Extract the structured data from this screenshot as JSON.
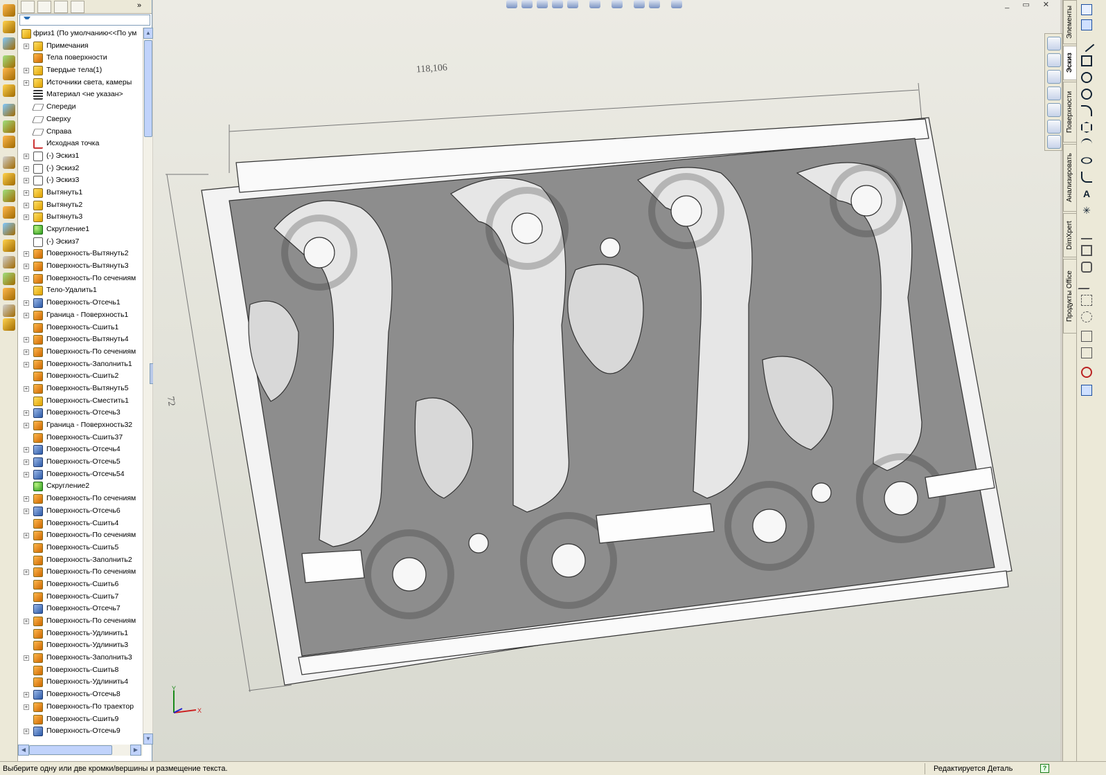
{
  "feature_tree": {
    "root": "фриз1  (По умолчанию<<По ум",
    "items": [
      {
        "label": "Примечания",
        "kind": "annot",
        "expand": true
      },
      {
        "label": "Тела поверхности",
        "kind": "surf",
        "expand": false
      },
      {
        "label": "Твердые тела(1)",
        "kind": "solid",
        "expand": true
      },
      {
        "label": "Источники света, камеры",
        "kind": "light",
        "expand": true
      },
      {
        "label": "Материал <не указан>",
        "kind": "mat",
        "expand": false
      },
      {
        "label": "Спереди",
        "kind": "plane",
        "expand": false
      },
      {
        "label": "Сверху",
        "kind": "plane",
        "expand": false
      },
      {
        "label": "Справа",
        "kind": "plane",
        "expand": false
      },
      {
        "label": "Исходная точка",
        "kind": "origin",
        "expand": false
      },
      {
        "label": "(-) Эскиз1",
        "kind": "sketch",
        "expand": true
      },
      {
        "label": "(-) Эскиз2",
        "kind": "sketch",
        "expand": true
      },
      {
        "label": "(-) Эскиз3",
        "kind": "sketch",
        "expand": true
      },
      {
        "label": "Вытянуть1",
        "kind": "solid",
        "expand": true
      },
      {
        "label": "Вытянуть2",
        "kind": "solid",
        "expand": true
      },
      {
        "label": "Вытянуть3",
        "kind": "solid",
        "expand": true
      },
      {
        "label": "Скругление1",
        "kind": "fillet",
        "expand": false
      },
      {
        "label": "(-) Эскиз7",
        "kind": "sketch",
        "expand": false
      },
      {
        "label": "Поверхность-Вытянуть2",
        "kind": "surf",
        "expand": true
      },
      {
        "label": "Поверхность-Вытянуть3",
        "kind": "surf",
        "expand": true
      },
      {
        "label": "Поверхность-По сечениям",
        "kind": "surf",
        "expand": true
      },
      {
        "label": "Тело-Удалить1",
        "kind": "solid",
        "expand": false
      },
      {
        "label": "Поверхность-Отсечь1",
        "kind": "cut",
        "expand": true
      },
      {
        "label": "Граница - Поверхность1",
        "kind": "surf",
        "expand": true
      },
      {
        "label": "Поверхность-Сшить1",
        "kind": "surf",
        "expand": false
      },
      {
        "label": "Поверхность-Вытянуть4",
        "kind": "surf",
        "expand": true
      },
      {
        "label": "Поверхность-По сечениям",
        "kind": "surf",
        "expand": true
      },
      {
        "label": "Поверхность-Заполнить1",
        "kind": "surf",
        "expand": true
      },
      {
        "label": "Поверхность-Сшить2",
        "kind": "surf",
        "expand": false
      },
      {
        "label": "Поверхность-Вытянуть5",
        "kind": "surf",
        "expand": true
      },
      {
        "label": "Поверхность-Сместить1",
        "kind": "solid",
        "expand": false
      },
      {
        "label": "Поверхность-Отсечь3",
        "kind": "cut",
        "expand": true
      },
      {
        "label": "Граница - Поверхность32",
        "kind": "surf",
        "expand": true
      },
      {
        "label": "Поверхность-Сшить37",
        "kind": "surf",
        "expand": false
      },
      {
        "label": "Поверхность-Отсечь4",
        "kind": "cut",
        "expand": true
      },
      {
        "label": "Поверхность-Отсечь5",
        "kind": "cut",
        "expand": true
      },
      {
        "label": "Поверхность-Отсечь54",
        "kind": "cut",
        "expand": true
      },
      {
        "label": "Скругление2",
        "kind": "fillet",
        "expand": false
      },
      {
        "label": "Поверхность-По сечениям",
        "kind": "surf",
        "expand": true
      },
      {
        "label": "Поверхность-Отсечь6",
        "kind": "cut",
        "expand": true
      },
      {
        "label": "Поверхность-Сшить4",
        "kind": "surf",
        "expand": false
      },
      {
        "label": "Поверхность-По сечениям",
        "kind": "surf",
        "expand": true
      },
      {
        "label": "Поверхность-Сшить5",
        "kind": "surf",
        "expand": false
      },
      {
        "label": "Поверхность-Заполнить2",
        "kind": "surf",
        "expand": false
      },
      {
        "label": "Поверхность-По сечениям",
        "kind": "surf",
        "expand": true
      },
      {
        "label": "Поверхность-Сшить6",
        "kind": "surf",
        "expand": false
      },
      {
        "label": "Поверхность-Сшить7",
        "kind": "surf",
        "expand": false
      },
      {
        "label": "Поверхность-Отсечь7",
        "kind": "cut",
        "expand": false
      },
      {
        "label": "Поверхность-По сечениям",
        "kind": "surf",
        "expand": true
      },
      {
        "label": "Поверхность-Удлинить1",
        "kind": "surf",
        "expand": false
      },
      {
        "label": "Поверхность-Удлинить3",
        "kind": "surf",
        "expand": false
      },
      {
        "label": "Поверхность-Заполнить3",
        "kind": "surf",
        "expand": true
      },
      {
        "label": "Поверхность-Сшить8",
        "kind": "surf",
        "expand": false
      },
      {
        "label": "Поверхность-Удлинить4",
        "kind": "surf",
        "expand": false
      },
      {
        "label": "Поверхность-Отсечь8",
        "kind": "cut",
        "expand": true
      },
      {
        "label": "Поверхность-По траектор",
        "kind": "surf",
        "expand": true
      },
      {
        "label": "Поверхность-Сшить9",
        "kind": "surf",
        "expand": false
      },
      {
        "label": "Поверхность-Отсечь9",
        "kind": "cut",
        "expand": true
      }
    ]
  },
  "viewport": {
    "dimension_width": "118,106",
    "dimension_height": "72",
    "triad_x": "X",
    "triad_y": "Y"
  },
  "command_tabs": [
    "Элементы",
    "Эскиз",
    "Поверхности",
    "Анализировать",
    "DimXpert",
    "Продукты Office"
  ],
  "active_tab": "Эскиз",
  "status_bar": {
    "message": "Выберите одну или две кромки/вершины и размещение текста.",
    "mode": "Редактируется Деталь",
    "help": "?"
  },
  "window_controls": "_ ▭ ✕",
  "colors": {
    "tree_bg": "#ffffff",
    "chrome": "#ece9d8",
    "viewport_top": "#ecebe4",
    "viewport_bottom": "#d8d9d0",
    "model": "#f2f2f2"
  }
}
